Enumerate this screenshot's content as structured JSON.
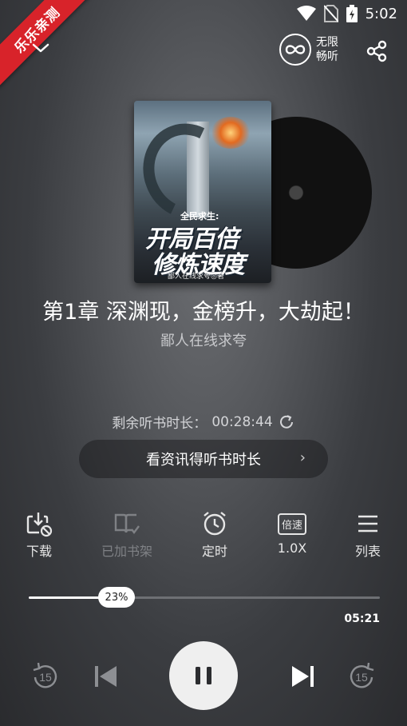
{
  "status_bar": {
    "time": "5:02"
  },
  "ribbon": {
    "text": "乐乐亲测"
  },
  "header": {
    "unlimited_label_line1": "无限",
    "unlimited_label_line2": "畅听"
  },
  "cover": {
    "subtitle": "全民求生:",
    "title_line1": "开局百倍",
    "title_line2": "修炼速度",
    "author_line": "鄙人在线求夸◎著"
  },
  "track": {
    "chapter_title": "第1章 深渊现，金榜升，大劫起！",
    "author": "鄙人在线求夸"
  },
  "remaining": {
    "label": "剩余听书时长：",
    "value": "00:28:44"
  },
  "earn_button": {
    "label": "看资讯得听书时长",
    "chevron": "›"
  },
  "toolbar": {
    "download": "下载",
    "bookshelf": "已加书架",
    "timer": "定时",
    "speed_badge": "倍速",
    "speed": "1.0X",
    "list": "列表"
  },
  "progress": {
    "percent_label": "23%",
    "percent": 0.25,
    "duration": "05:21"
  },
  "controls": {
    "rewind_seconds": "15",
    "forward_seconds": "15"
  },
  "colors": {
    "ribbon": "#d8232a",
    "disabled": "#7f8185"
  }
}
